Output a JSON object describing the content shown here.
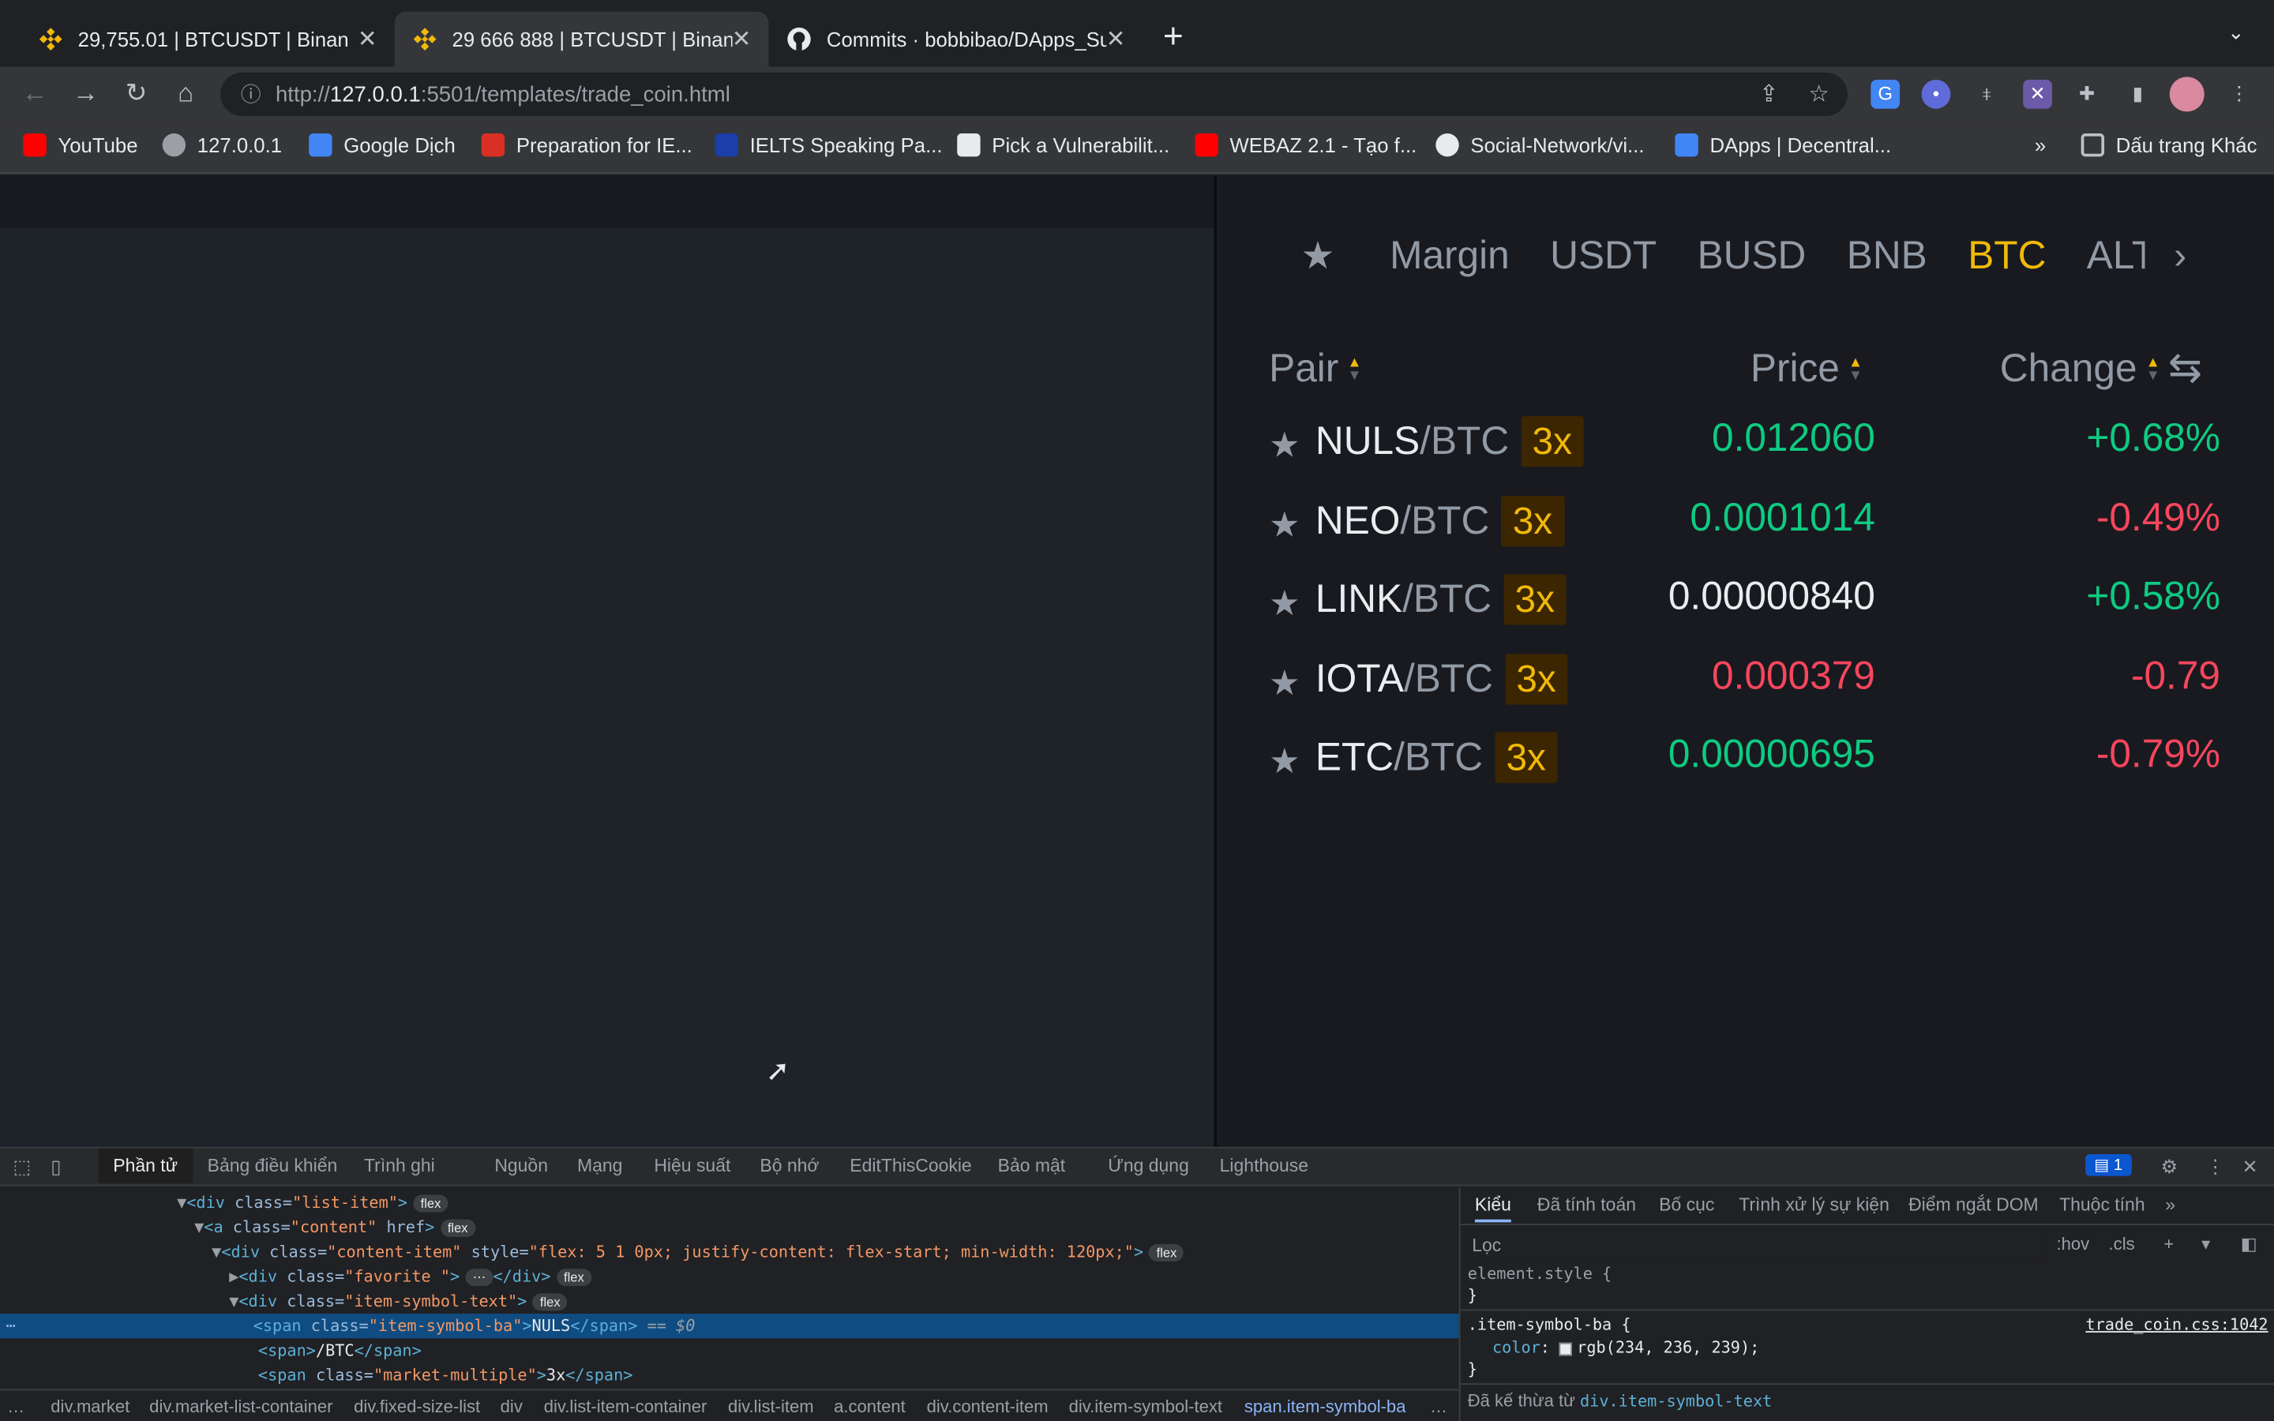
{
  "browser": {
    "tabs": [
      {
        "title": "29,755.01 | BTCUSDT | Binan",
        "favicon": "binance-icon"
      },
      {
        "title": "29 666 888 | BTCUSDT | Binan",
        "favicon": "binance-icon",
        "active": true
      },
      {
        "title": "Commits · bobbibao/DApps_Su",
        "favicon": "github-icon"
      }
    ],
    "url_prefix": "http://",
    "url_host": "127.0.0.1",
    "url_rest": ":5501/templates/trade_coin.html",
    "bookmarks": [
      {
        "label": "YouTube",
        "color": "#ff0000"
      },
      {
        "label": "127.0.0.1",
        "color": "#9aa0a6"
      },
      {
        "label": "Google Dịch",
        "color": "#4285f4"
      },
      {
        "label": "Preparation for IE...",
        "color": "#d93025"
      },
      {
        "label": "IELTS Speaking Pa...",
        "color": "#1a3fa8"
      },
      {
        "label": "Pick a Vulnerabilit...",
        "color": "#e8eaed"
      },
      {
        "label": "WEBAZ 2.1 - Tạo f...",
        "color": "#ff0000"
      },
      {
        "label": "Social-Network/vi...",
        "color": "#e8eaed"
      },
      {
        "label": "DApps | Decentral...",
        "color": "#4285f4"
      }
    ],
    "bookmarks_more": "»",
    "other_bookmarks": "Dấu trang Khác"
  },
  "market": {
    "tabs": [
      "Margin",
      "USDT",
      "BUSD",
      "BNB",
      "BTC",
      "ALTS"
    ],
    "selected_tab": "BTC",
    "headers": {
      "pair": "Pair",
      "price": "Price",
      "change": "Change"
    },
    "rows": [
      {
        "base": "NULS",
        "quote": "/BTC",
        "mult": "3x",
        "price": "0.012060",
        "price_color": "#0ecb81",
        "change": "+0.68%",
        "change_color": "#0ecb81"
      },
      {
        "base": "NEO",
        "quote": "/BTC",
        "mult": "3x",
        "price": "0.0001014",
        "price_color": "#0ecb81",
        "change": "-0.49%",
        "change_color": "#f6465d"
      },
      {
        "base": "LINK",
        "quote": "/BTC",
        "mult": "3x",
        "price": "0.00000840",
        "price_color": "#eaecef",
        "change": "+0.58%",
        "change_color": "#0ecb81"
      },
      {
        "base": "IOTA",
        "quote": "/BTC",
        "mult": "3x",
        "price": "0.000379",
        "price_color": "#f6465d",
        "change": "-0.79",
        "change_color": "#f6465d"
      },
      {
        "base": "ETC",
        "quote": "/BTC",
        "mult": "3x",
        "price": "0.00000695",
        "price_color": "#0ecb81",
        "change": "-0.79%",
        "change_color": "#f6465d"
      }
    ]
  },
  "devtools": {
    "tabs": [
      "Phần tử",
      "Bảng điều khiển",
      "Trình ghi",
      "Nguồn",
      "Mạng",
      "Hiệu suất",
      "Bộ nhớ",
      "EditThisCookie",
      "Bảo mật",
      "Ứng dụng",
      "Lighthouse"
    ],
    "issues_count": "1",
    "styles_tabs": [
      "Kiểu",
      "Đã tính toán",
      "Bố cục",
      "Trình xử lý sự kiện",
      "Điểm ngắt DOM",
      "Thuộc tính"
    ],
    "filter_placeholder": "Lọc",
    "hov": ":hov",
    "cls": ".cls",
    "element_style": "element.style {",
    "close_brace": "}",
    "rule_selector": ".item-symbol-ba {",
    "rule_prop": "color",
    "rule_value": "rgb(234, 236, 239);",
    "rule_source": "trade_coin.css:1042",
    "inherited_label": "Đã kế thừa từ",
    "inherited_from": "div.item-symbol-text",
    "dom": {
      "l1_tag": "<div class=",
      "l1_val": "\"list-item\"",
      "l2_val": "\"content\"",
      "l3_val": "\"content-item\"",
      "l3_style": "\"flex: 5 1 0px; justify-content: flex-start; min-width: 120px;\"",
      "l4_val": "\"favorite \"",
      "l5_val": "\"item-symbol-text\"",
      "l6_val": "\"item-symbol-ba\"",
      "l6_text": "NULS",
      "l6_eq": "== $0",
      "l7_text": "/BTC",
      "l8_val": "\"market-multiple\"",
      "l8_text": "3x",
      "badge": "flex"
    },
    "breadcrumbs": [
      "div.market",
      "div.market-list-container",
      "div.fixed-size-list",
      "div",
      "div.list-item-container",
      "div.list-item",
      "a.content",
      "div.content-item",
      "div.item-symbol-text",
      "span.item-symbol-ba"
    ]
  }
}
